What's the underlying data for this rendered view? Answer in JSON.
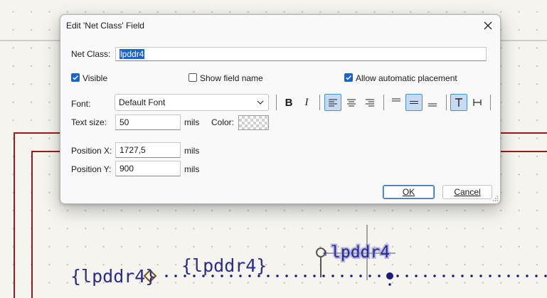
{
  "schematic": {
    "net_label_left": "{lpddr4}",
    "net_label_mid": "{lpddr4}",
    "net_label_selected": "lpddr4",
    "colors": {
      "wire": "#9b1b1b",
      "bus": "#1a1a7a",
      "label_text": "#2b2b8c",
      "flag": "#7a5500",
      "highlight": "#8f8fe0"
    }
  },
  "dialog": {
    "title": "Edit 'Net Class' Field",
    "net_class_label": "Net Class:",
    "net_class_value": "lpddr4",
    "visible_label": "Visible",
    "visible_checked": true,
    "show_field_name_label": "Show field name",
    "show_field_name_checked": false,
    "allow_auto_placement_label": "Allow automatic placement",
    "allow_auto_placement_checked": true,
    "font_label": "Font:",
    "font_value": "Default Font",
    "text_size_label": "Text size:",
    "text_size_value": "50",
    "text_size_units": "mils",
    "color_label": "Color:",
    "position_x_label": "Position X:",
    "position_x_value": "1727,5",
    "position_x_units": "mils",
    "position_y_label": "Position Y:",
    "position_y_value": "900",
    "position_y_units": "mils",
    "ok_label": "OK",
    "cancel_label": "Cancel",
    "toolbar": {
      "bold": "B",
      "italic": "I",
      "active": [
        "align-left",
        "valign-center",
        "orient-horizontal"
      ]
    },
    "icons": [
      "close-icon",
      "chevron-down-icon",
      "bold-icon",
      "italic-icon",
      "align-left-icon",
      "align-center-icon",
      "align-right-icon",
      "valign-top-icon",
      "valign-center-icon",
      "valign-bottom-icon",
      "orient-horizontal-icon",
      "orient-vertical-icon",
      "resize-grip-icon"
    ],
    "accent_color": "#1a63c2"
  }
}
